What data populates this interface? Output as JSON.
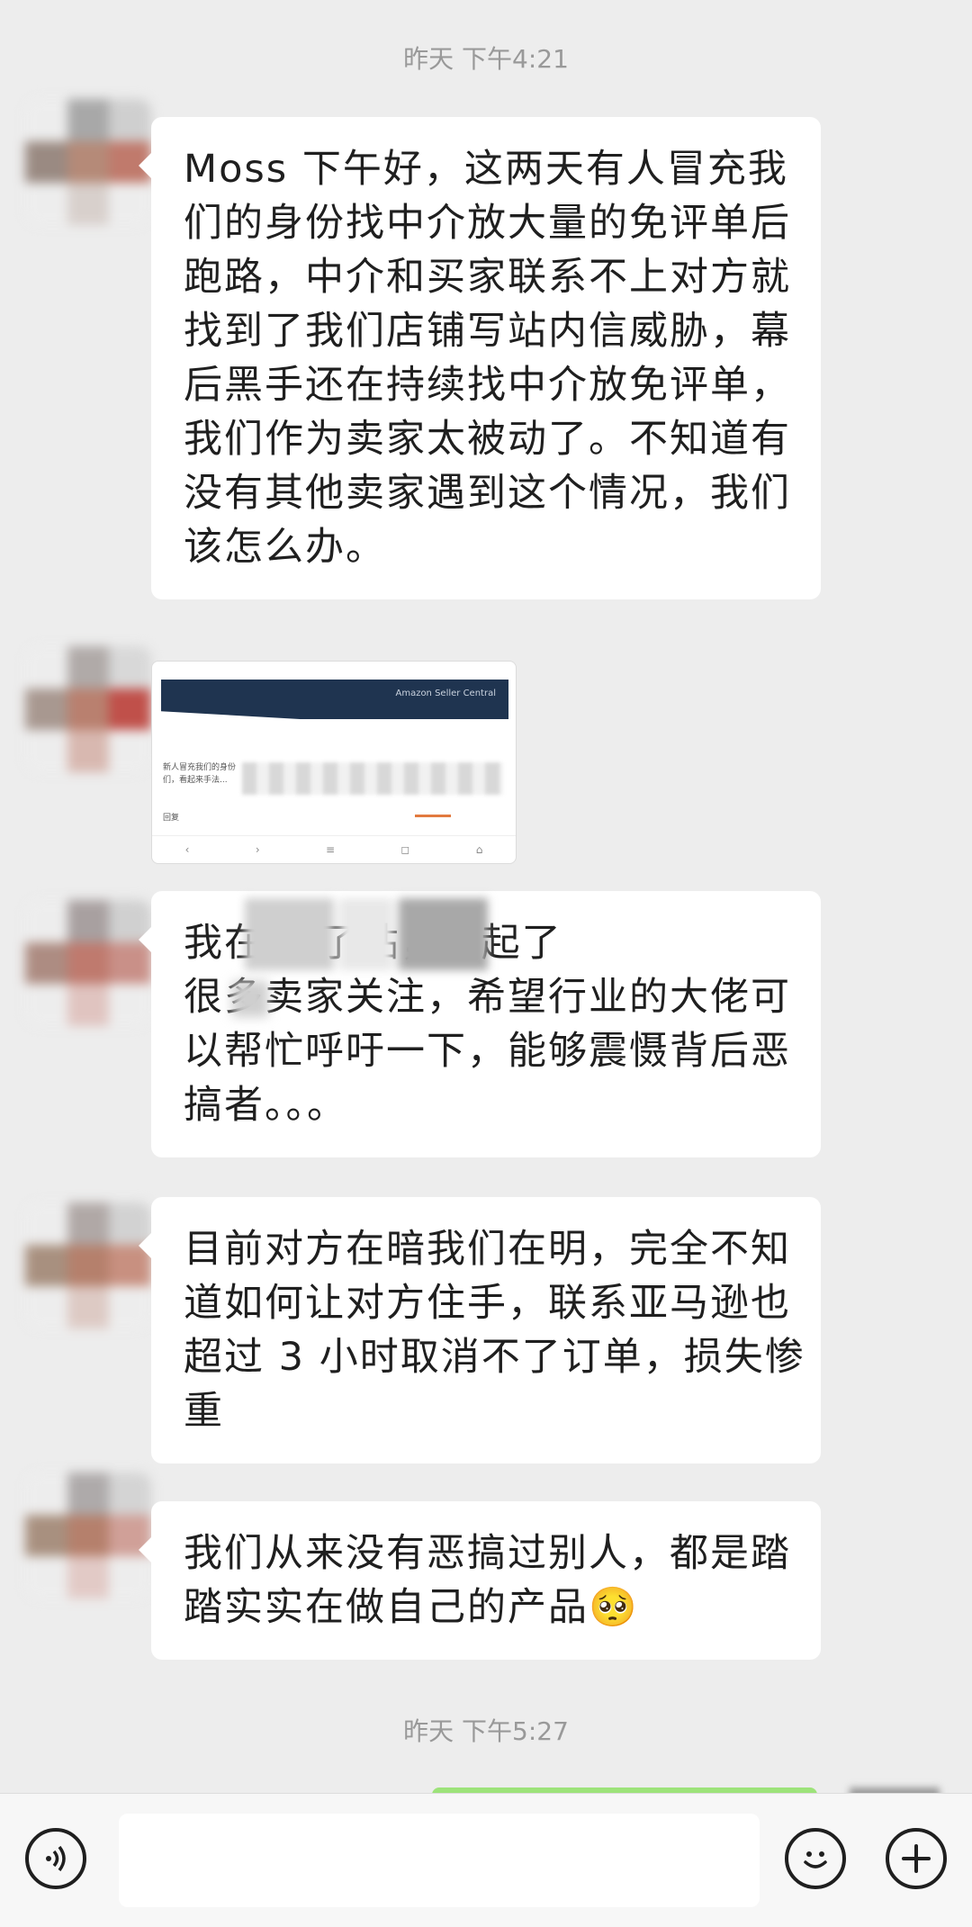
{
  "chat": {
    "timestamp_1": "昨天 下午4:21",
    "timestamp_2": "昨天 下午5:27",
    "message_1": {
      "lines": [
        "Moss 下午好，这两天有人冒充我",
        "们的身份找中介放大量的免评单后",
        "跑路，中介和买家联系不上对方就",
        "找到了我们店铺写站内信威胁，幕",
        "后黑手还在持续找中介放免评单，",
        "我们作为卖家太被动了。不知道有",
        "没有其他卖家遇到这个情况，我们",
        "该怎么办。"
      ]
    },
    "image_message": {
      "header_text": "Amazon Seller Central",
      "line_1": "新人冒充我们的身份",
      "line_2": "们，看起来手法...",
      "line_3": "回复",
      "nav_icons": [
        "‹",
        "›",
        "≡",
        "◻",
        "⌂"
      ]
    },
    "message_3": {
      "lines": [
        "我在                        发了贴，引起了",
        "很多卖家关注，希望行业的大佬可",
        "以帮忙呼吁一下，能够震慑背后恶",
        "搞者。。。"
      ]
    },
    "message_4": {
      "lines": [
        "目前对方在暗我们在明，完全不知",
        "道如何让对方住手，联系亚马逊也",
        "超过 3 小时取消不了订单，损失惨",
        "重"
      ]
    },
    "message_5": {
      "lines": [
        "我们从来没有恶搞过别人，都是踏",
        "踏实实在做自己的产品"
      ],
      "emoji": "🥺"
    }
  },
  "input_bar": {
    "voice_icon": "voice-icon",
    "emoji_icon": "emoji-icon",
    "plus_icon": "plus-icon"
  }
}
